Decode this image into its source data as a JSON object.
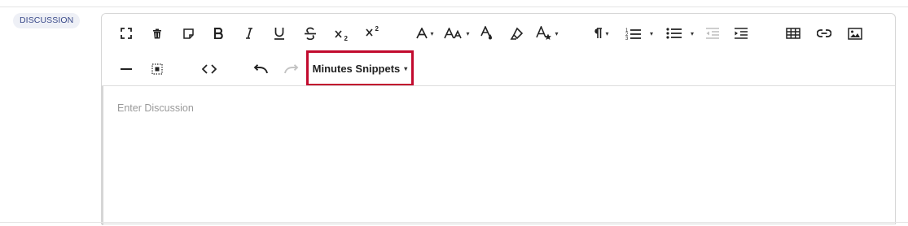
{
  "section": {
    "label": "DISCUSSION"
  },
  "editor": {
    "placeholder": "Enter Discussion",
    "snippets_label": "Minutes Snippets",
    "caret_glyph": "▾"
  },
  "toolbar": {
    "row1": [
      "fullscreen-icon",
      "delete-icon",
      "note-icon",
      "bold-icon",
      "italic-icon",
      "underline-icon",
      "strikethrough-icon",
      "subscript-icon",
      "superscript-icon",
      "font-family-icon",
      "font-size-icon",
      "text-color-icon",
      "highlight-icon",
      "text-style-icon",
      "paragraph-format-icon",
      "ordered-list-icon",
      "unordered-list-icon",
      "outdent-icon",
      "indent-icon",
      "table-icon",
      "link-icon",
      "image-icon"
    ],
    "row2": [
      "horizontal-line-icon",
      "select-all-icon",
      "code-view-icon",
      "undo-icon",
      "redo-icon"
    ]
  },
  "colors": {
    "accent_border": "#c20a2e",
    "badge_bg": "#eef0f6",
    "badge_text": "#3a4a8a"
  }
}
